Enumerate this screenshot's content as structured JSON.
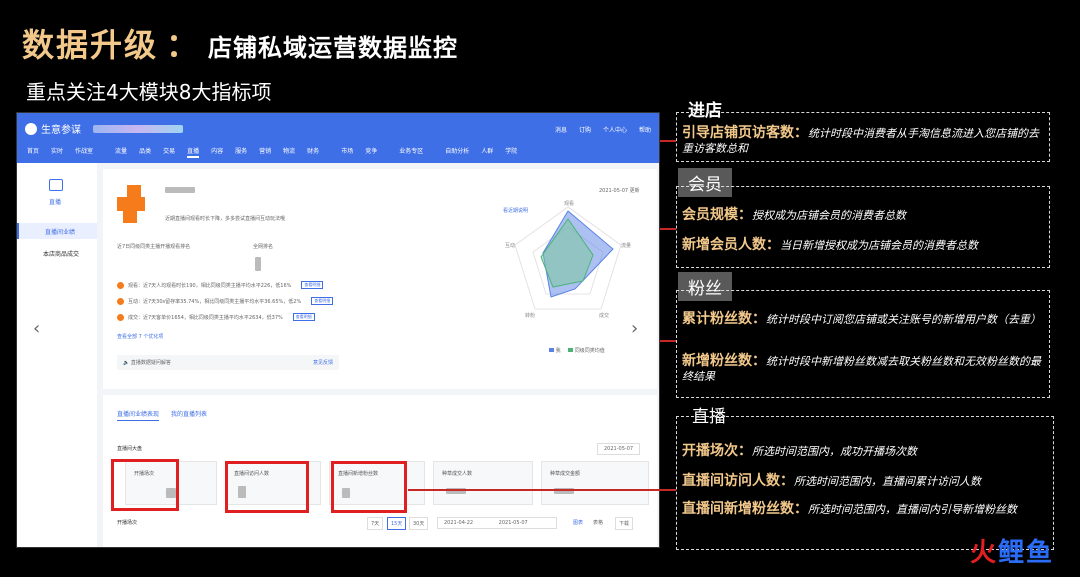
{
  "header": {
    "title": "数据升级",
    "colon": "：",
    "subtitle": "店铺私域运营数据监控",
    "line2": "重点关注4大模块8大指标项"
  },
  "screenshot": {
    "app_name": "生意参谋",
    "top_right": [
      "消息",
      "订购",
      "个人中心",
      "帮助"
    ],
    "nav": [
      "首页",
      "实时",
      "作战室",
      "流量",
      "品类",
      "交易",
      "直播",
      "内容",
      "服务",
      "营销",
      "物流",
      "财务",
      "市场",
      "竞争",
      "业务专区",
      "自助分析",
      "人群",
      "学院"
    ],
    "nav_active": "直播",
    "sidebar": {
      "icon_label": "直播",
      "item1": "直播间业绩",
      "item2": "本店商品成交"
    },
    "date_top": "2021-05-07 更新",
    "intro": "近期直播间观看时长下降，多多尝试直播间互动玩法哦",
    "live_rank_label": "近7日同级同类主播开播观看排名",
    "rank_label2": "全网排名",
    "tips": [
      "观看：近7天人均观看时长190，相比同级同类主播平均水平226，低16%",
      "互动：近7天30s留存率35.74%，相比同级同类主播平均水平36.65%，低2%",
      "成交：近7天客单价1654，相比同级同类主播平均水平2634，低37%"
    ],
    "tip_button": "查看明细",
    "more_link": "查看全部 7 个优化项",
    "faq": "直播数据疑问解答",
    "faq_link": "意见反馈",
    "radar_link": "看近期说明",
    "radar_legend": [
      "我",
      "同级同类均值"
    ],
    "radar_axes": [
      "观看",
      "流量",
      "成交",
      "转粉",
      "互动"
    ],
    "tabs": [
      "直播间业绩表现",
      "我的直播列表"
    ],
    "overview_label": "直播间大盘",
    "overview_date": "2021-05-07",
    "metrics": [
      "开播场次",
      "直播间访问人数",
      "直播间新增粉丝数",
      "种草成交人数",
      "种草成交金额"
    ],
    "bottom_label": "开播场次",
    "ranges": [
      "7天",
      "15天",
      "30天"
    ],
    "range_start": "2021-04-22",
    "range_end": "2021-05-07",
    "right_tools": [
      "图表",
      "表格",
      "下载"
    ]
  },
  "annotations": {
    "store": {
      "tag": "进店",
      "items": [
        {
          "term": "引导店铺页访客数",
          "sep": "：",
          "desc": "统计时段中消费者从手淘信息流进入您店铺的去重访客数总和"
        }
      ]
    },
    "member": {
      "tag": "会员",
      "items": [
        {
          "term": "会员规模",
          "sep": "：",
          "desc": "授权成为店铺会员的消费者总数"
        },
        {
          "term": "新增会员人数",
          "sep": "：",
          "desc": "当日新增授权成为店铺会员的消费者总数"
        }
      ]
    },
    "fans": {
      "tag": "粉丝",
      "items": [
        {
          "term": "累计粉丝数",
          "sep": "：",
          "desc": "统计时段中订阅您店铺或关注账号的新增用户数（去重）"
        },
        {
          "term": "新增粉丝数",
          "sep": "：",
          "desc": "统计时段中新增粉丝数减去取关粉丝数和无效粉丝数的最终结果"
        }
      ]
    },
    "live": {
      "tag": "直播",
      "items": [
        {
          "term": "开播场次",
          "sep": "：",
          "desc": "所选时间范围内，成功开播场次数"
        },
        {
          "term": "直播间访问人数",
          "sep": "：",
          "desc": "所选时间范围内，直播间累计访问人数"
        },
        {
          "term": "直播间新增粉丝数",
          "sep": "：",
          "desc": "所选时间范围内，直播间内引导新增粉丝数"
        }
      ]
    }
  },
  "watermark": {
    "part1": "火",
    "part2": "鲤鱼"
  },
  "colors": {
    "accent": "#f3c98b",
    "brand_blue": "#3f6fe6",
    "highlight_red": "#e02020"
  }
}
